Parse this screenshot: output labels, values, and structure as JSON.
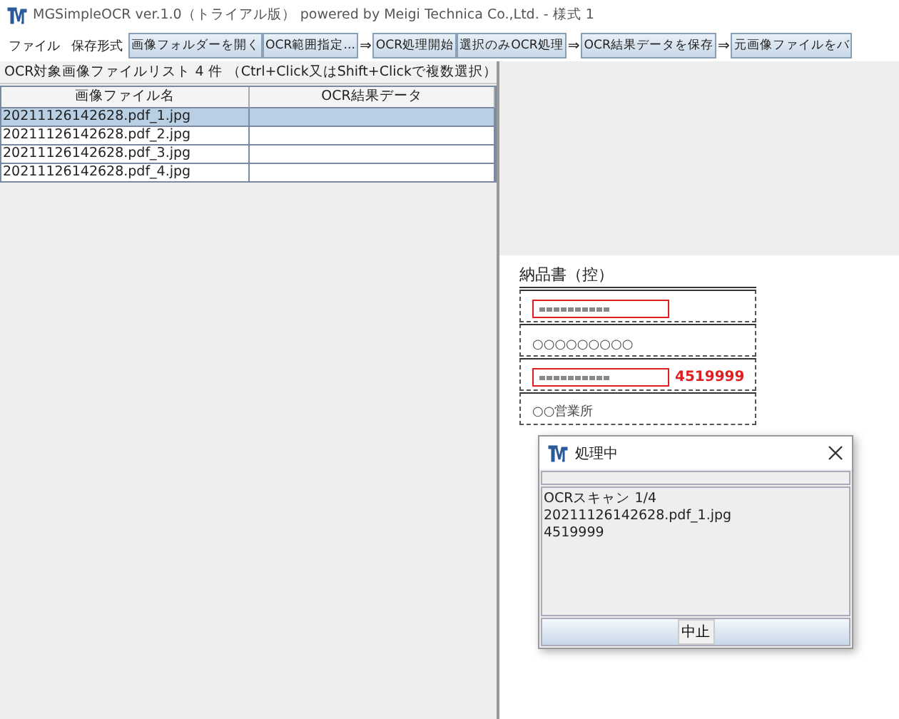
{
  "window": {
    "title": "MGSimpleOCR ver.1.0（トライアル版）  powered by Meigi Technica Co.,Ltd. - 様式 1"
  },
  "menu": [
    "ファイル",
    "保存形式"
  ],
  "toolbar": [
    {
      "kind": "button",
      "label": "画像フォルダーを開く"
    },
    {
      "kind": "button",
      "label": "OCR範囲指定..."
    },
    {
      "kind": "arrow",
      "label": "⇒"
    },
    {
      "kind": "button",
      "label": "OCR処理開始"
    },
    {
      "kind": "button",
      "label": "選択のみOCR処理"
    },
    {
      "kind": "arrow",
      "label": "⇒"
    },
    {
      "kind": "button",
      "label": "OCR結果データを保存"
    },
    {
      "kind": "arrow",
      "label": "⇒"
    },
    {
      "kind": "button",
      "label": "元画像ファイルをバ"
    }
  ],
  "list_caption": "OCR対象画像ファイルリスト  4 件    （Ctrl+Click又はShift+Clickで複数選択）",
  "table": {
    "columns": [
      "画像ファイル名",
      "OCR結果データ"
    ],
    "rows": [
      {
        "cells": [
          "20211126142628.pdf_1.jpg",
          ""
        ],
        "selected": true
      },
      {
        "cells": [
          "20211126142628.pdf_2.jpg",
          ""
        ],
        "selected": false
      },
      {
        "cells": [
          "20211126142628.pdf_3.jpg",
          ""
        ],
        "selected": false
      },
      {
        "cells": [
          "20211126142628.pdf_4.jpg",
          ""
        ],
        "selected": false
      }
    ]
  },
  "document": {
    "title": "納品書（控）",
    "fields": [
      {
        "kind": "box"
      },
      {
        "kind": "text",
        "value": "○○○○○○○○○"
      },
      {
        "kind": "box",
        "result": "4519999"
      },
      {
        "kind": "text",
        "value": "○○営業所"
      }
    ]
  },
  "dialog": {
    "title": "処理中",
    "progress": {
      "level": 0
    },
    "lines": [
      "OCRスキャン    1/4",
      "20211126142628.pdf_1.jpg",
      "4519999"
    ],
    "button": "中止"
  }
}
